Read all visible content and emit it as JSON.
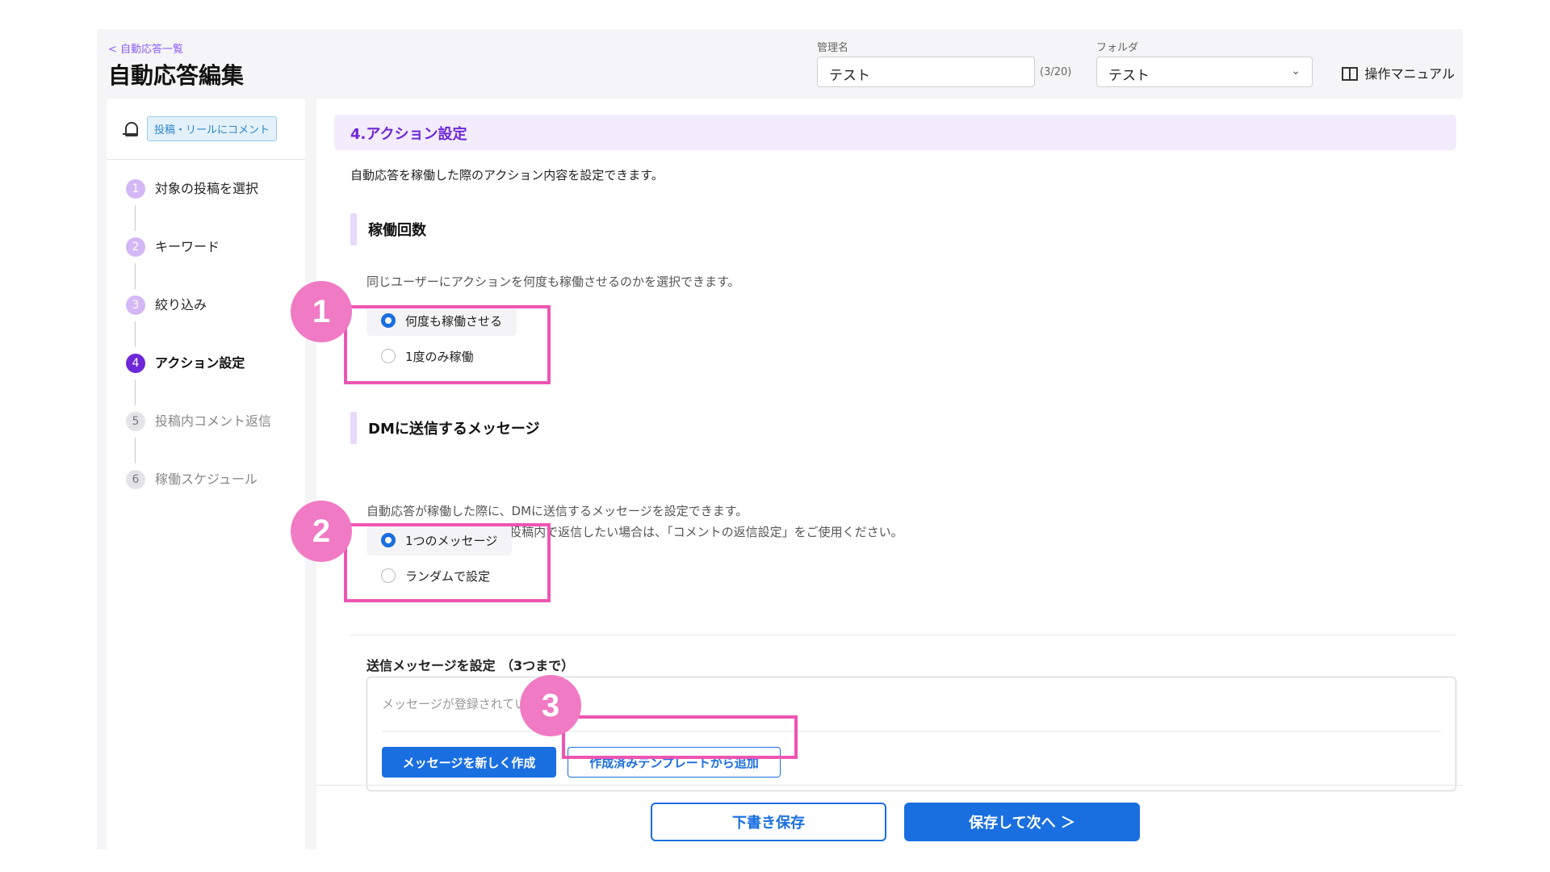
{
  "header": {
    "back_link": "< 自動応答一覧",
    "title": "自動応答編集",
    "name_label": "管理名",
    "name_value": "テスト",
    "name_counter": "(3/20)",
    "folder_label": "フォルダ",
    "folder_value": "テスト",
    "manual_label": "操作マニュアル"
  },
  "sidebar": {
    "trigger_badge": "投稿・リールにコメント",
    "steps": [
      {
        "num": "1",
        "label": "対象の投稿を選択"
      },
      {
        "num": "2",
        "label": "キーワード"
      },
      {
        "num": "3",
        "label": "絞り込み"
      },
      {
        "num": "4",
        "label": "アクション設定"
      },
      {
        "num": "5",
        "label": "投稿内コメント返信"
      },
      {
        "num": "6",
        "label": "稼働スケジュール"
      }
    ]
  },
  "main": {
    "section_title": "4.アクション設定",
    "intro": "自動応答を稼働した際のアクション内容を設定できます。",
    "run_count": {
      "heading": "稼働回数",
      "desc": "同じユーザーにアクションを何度も稼働させるのかを選択できます。",
      "options": [
        "何度も稼働させる",
        "1度のみ稼働"
      ]
    },
    "dm": {
      "heading": "DMに送信するメッセージ",
      "desc1": "自動応答が稼働した際に、DMに送信するメッセージを設定できます。",
      "desc2": "※投稿のコメントに対して投稿内で返信したい場合は、「コメントの返信設定」をご使用ください。",
      "options": [
        "1つのメッセージ",
        "ランダムで設定"
      ]
    },
    "messages": {
      "label": "送信メッセージを設定",
      "limit": "（3つまで）",
      "placeholder": "メッセージが登録されていません。",
      "new_button": "メッセージを新しく作成",
      "template_button": "作成済みテンプレートから追加"
    }
  },
  "annotations": [
    "1",
    "2",
    "3"
  ],
  "footer": {
    "draft_button": "下書き保存",
    "next_button": "保存して次へ ＞"
  },
  "colors": {
    "accent": "#6d28d9",
    "primary": "#1a6fe0",
    "annotation": "#ee55b3"
  }
}
